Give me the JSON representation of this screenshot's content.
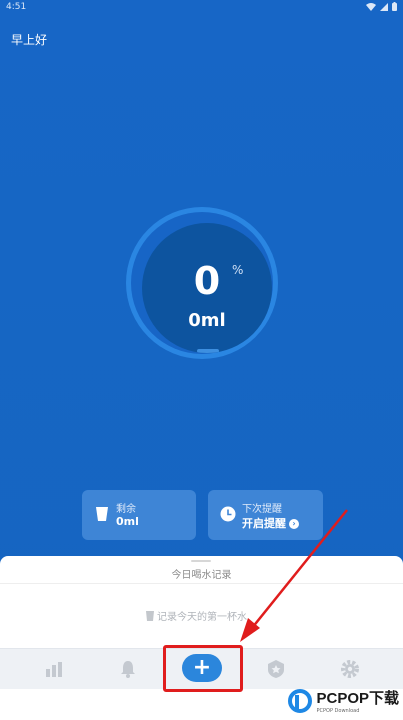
{
  "status_bar": {
    "time": "4:51"
  },
  "greeting": "早上好",
  "progress": {
    "percent_value": "0",
    "percent_sign": "%",
    "amount": "0ml"
  },
  "cards": {
    "remaining": {
      "label": "剩余",
      "value": "0ml",
      "icon": "cup-icon"
    },
    "next_reminder": {
      "label": "下次提醒",
      "value": "开启提醒",
      "icon": "clock-icon"
    }
  },
  "sheet": {
    "title": "今日喝水记录",
    "empty_text": "记录今天的第一杯水"
  },
  "tabs": [
    {
      "name": "stats",
      "icon": "bar-chart-icon"
    },
    {
      "name": "reminder",
      "icon": "bell-icon"
    },
    {
      "name": "add",
      "label": "+"
    },
    {
      "name": "achievements",
      "icon": "badge-icon"
    },
    {
      "name": "settings",
      "icon": "gear-icon"
    }
  ],
  "watermark": {
    "text": "PCPOP下载",
    "subtext": "PCPOP Download"
  },
  "colors": {
    "background": "#1565c0",
    "accent": "#2b86dc",
    "highlight": "#e01d1d"
  }
}
